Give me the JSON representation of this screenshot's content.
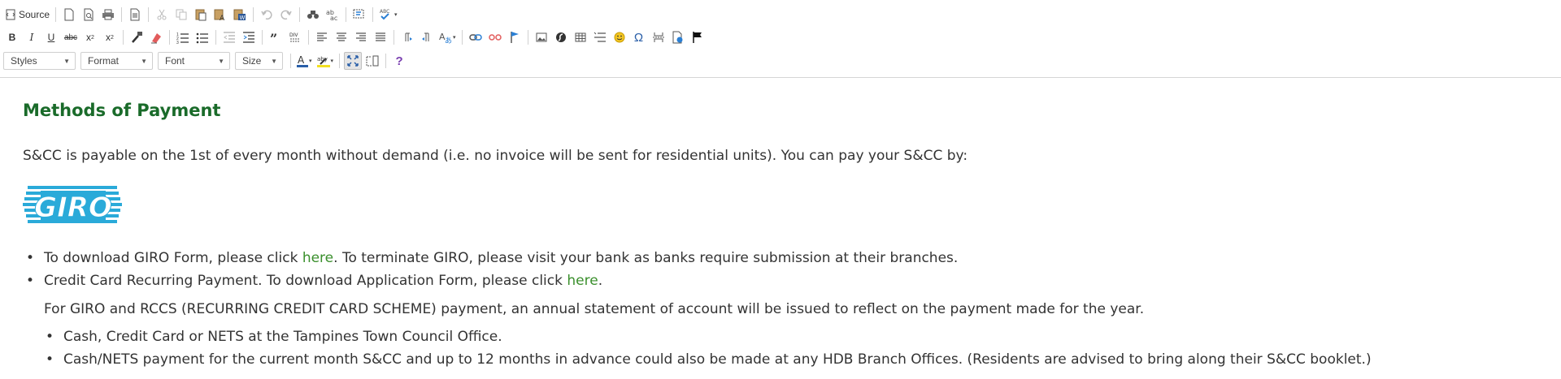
{
  "toolbar": {
    "source_label": "Source",
    "styles_label": "Styles",
    "format_label": "Format",
    "font_label": "Font",
    "size_label": "Size",
    "bold_label": "B",
    "italic_label": "I",
    "underline_label": "U",
    "strike_label": "abc",
    "subscript_label": "x",
    "superscript_label": "x",
    "help_label": "?",
    "omega_label": "Ω",
    "icons": [
      "source-icon",
      "new-page-icon",
      "preview-icon",
      "print-icon",
      "templates-icon",
      "cut-icon",
      "copy-icon",
      "paste-icon",
      "paste-text-icon",
      "paste-word-icon",
      "undo-icon",
      "redo-icon",
      "find-icon",
      "replace-icon",
      "select-all-icon",
      "spellcheck-icon",
      "copy-format-icon",
      "remove-format-icon",
      "numbered-list-icon",
      "bulleted-list-icon",
      "outdent-icon",
      "indent-icon",
      "blockquote-icon",
      "div-icon",
      "align-left-icon",
      "align-center-icon",
      "align-right-icon",
      "justify-icon",
      "ltr-icon",
      "rtl-icon",
      "language-icon",
      "link-icon",
      "unlink-icon",
      "anchor-icon",
      "image-icon",
      "flash-icon",
      "table-icon",
      "horizontal-rule-icon",
      "smiley-icon",
      "special-char-icon",
      "page-break-icon",
      "iframe-icon",
      "flag-icon",
      "text-color-icon",
      "bg-color-icon",
      "maximize-icon",
      "show-blocks-icon",
      "help-icon"
    ]
  },
  "document": {
    "heading": "Methods of Payment",
    "intro": "S&CC is payable on the 1st of every month without demand (i.e. no invoice will be sent for residential units). You can pay your S&CC by:",
    "logo_text": "GIRO",
    "bullets": [
      {
        "before": "To download GIRO Form, please click ",
        "link": "here",
        "after": ". To terminate GIRO, please visit your bank as banks require submission at their branches."
      },
      {
        "before": "Credit Card Recurring Payment. To download Application Form, please click ",
        "link": "here",
        "after": "."
      }
    ],
    "note": "For GIRO and RCCS (RECURRING CREDIT CARD SCHEME) payment, an annual statement of account will be issued to reflect on the payment made for the year.",
    "sub_bullets": [
      "Cash, Credit Card or NETS at the Tampines Town Council Office.",
      "Cash/NETS payment for the current month S&CC and up to 12 months in advance could also be made at any HDB Branch Offices. (Residents are advised to bring along their S&CC booklet.)"
    ]
  },
  "colors": {
    "heading": "#1a6b2a",
    "link": "#3a8f2c",
    "logo": "#2aaad9",
    "text": "#333333"
  }
}
